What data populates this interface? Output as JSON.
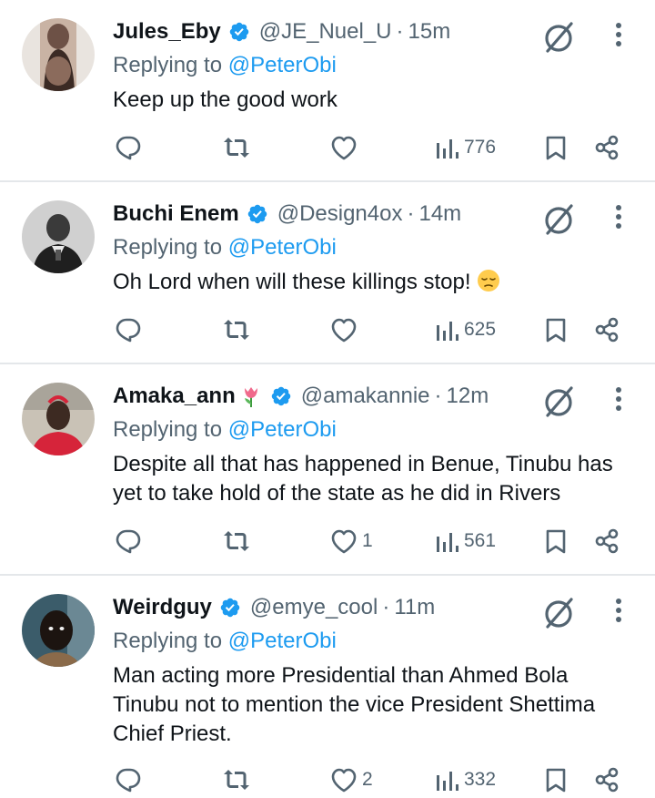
{
  "reply_prefix": "Replying to",
  "reply_mention": "@PeterObi",
  "tweets": [
    {
      "name": "Jules_Eby",
      "handle": "@JE_Nuel_U",
      "dot": "·",
      "time": "15m",
      "text": "Keep up the good work",
      "likes": "",
      "views": "776",
      "avatar_colors": [
        "#6d5146",
        "#c2a18f",
        "#3b2a24"
      ]
    },
    {
      "name": "Buchi Enem",
      "handle": "@Design4ox",
      "dot": "·",
      "time": "14m",
      "text": "Oh Lord when will these killings stop!",
      "emoji": "pensive-face",
      "likes": "",
      "views": "625",
      "avatar_colors": [
        "#d9d9d9",
        "#2b2b2b",
        "#7a7a7a"
      ]
    },
    {
      "name": "Amaka_ann",
      "name_emoji": "tulip",
      "handle": "@amakannie",
      "dot": "·",
      "time": "12m",
      "text": "Despite all that has happened in Benue, Tinubu has yet to take hold of the state as he did in Rivers",
      "likes": "1",
      "views": "561",
      "avatar_colors": [
        "#c9c2b6",
        "#3d2a22",
        "#d6243a"
      ]
    },
    {
      "name": "Weirdguy",
      "handle": "@emye_cool",
      "dot": "·",
      "time": "11m",
      "text": "Man acting more Presidential than Ahmed Bola Tinubu not to mention the vice President Shettima Chief Priest.",
      "likes": "2",
      "views": "332",
      "avatar_colors": [
        "#3b5c6a",
        "#1c1410",
        "#8a6a4a"
      ]
    }
  ],
  "colors": {
    "verified": "#1d9bf0",
    "secondary_text": "#536471",
    "link": "#1d9bf0",
    "divider": "#e4e7ea"
  }
}
